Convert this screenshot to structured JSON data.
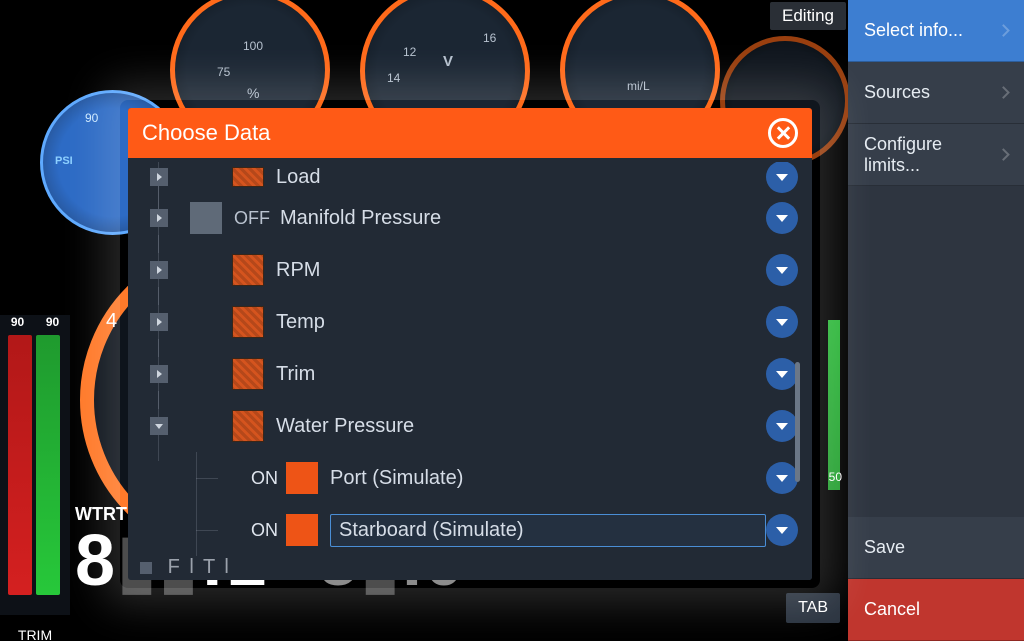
{
  "background": {
    "gauge_percent_unit": "%",
    "gauge_percent_tick": "100",
    "gauge_percent_tick2": "75",
    "gauge_volts_unit": "V",
    "gauge_volts_tick1": "14",
    "gauge_volts_tick2": "16",
    "gauge_econ_unit": "mi/L",
    "psi_label": "PSI",
    "psi_tick": "90",
    "big_gauge_tick": "4",
    "trim_left": "90",
    "trim_right": "90",
    "trim_caption": "TRIM",
    "green_marker_value": "50",
    "tab_label": "TAB",
    "wtrt_label": "WTRT",
    "wtrt_value_partial": "8",
    "wtrt_colon": ":1",
    "wtrt_right": "5",
    "wtrt_last": ".0"
  },
  "editing_badge": "Editing",
  "side_menu": {
    "select_info": "Select info...",
    "sources": "Sources",
    "configure_limits": "Configure limits...",
    "save": "Save",
    "cancel": "Cancel"
  },
  "modal": {
    "title": "Choose Data",
    "partial_top": "Load",
    "items": [
      {
        "state": "OFF",
        "swatch": "gray",
        "label": "Manifold Pressure"
      },
      {
        "state": "",
        "swatch": "orange",
        "label": "RPM"
      },
      {
        "state": "",
        "swatch": "orange",
        "label": "Temp"
      },
      {
        "state": "",
        "swatch": "orange",
        "label": "Trim"
      },
      {
        "state": "",
        "swatch": "orange",
        "label": "Water Pressure",
        "expanded": true
      }
    ],
    "children": [
      {
        "state": "ON",
        "swatch": "orange-solid",
        "label": "Port (Simulate)"
      },
      {
        "state": "ON",
        "swatch": "orange-solid",
        "label": "Starboard (Simulate)",
        "selected": true
      }
    ],
    "partial_bottom": "F   l T  l"
  }
}
